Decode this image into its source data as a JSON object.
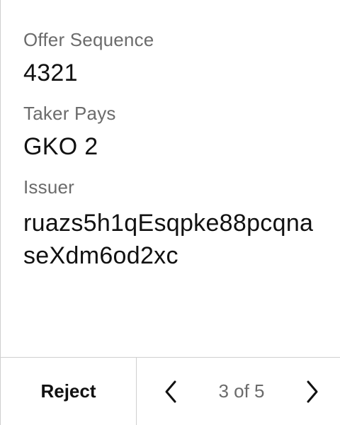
{
  "fields": {
    "offer_sequence": {
      "label": "Offer Sequence",
      "value": "4321"
    },
    "taker_pays": {
      "label": "Taker Pays",
      "value": "GKO 2"
    },
    "issuer": {
      "label": "Issuer",
      "value": "ruazs5h1qEsqpke88pcqnaseXdm6od2xc"
    }
  },
  "footer": {
    "reject_label": "Reject",
    "pagination": {
      "text": "3 of 5",
      "current": 3,
      "total": 5
    }
  },
  "icons": {
    "prev": "chevron-left-icon",
    "next": "chevron-right-icon"
  }
}
